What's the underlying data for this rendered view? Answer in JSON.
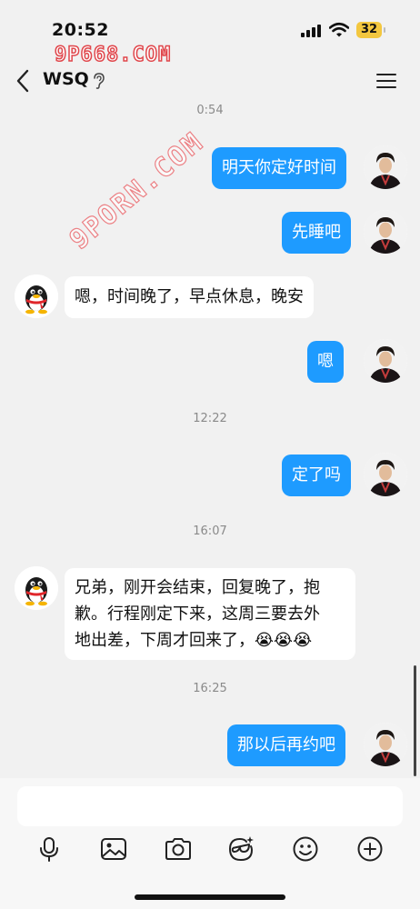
{
  "status_bar": {
    "time": "20:52",
    "battery": "32"
  },
  "watermark": {
    "top": "9P668.COM",
    "diagonal": "9PORN.COM"
  },
  "header": {
    "title": "WSQ"
  },
  "messages": [
    {
      "type": "timestamp",
      "text": "0:54"
    },
    {
      "type": "out",
      "text": "明天你定好时间"
    },
    {
      "type": "out",
      "text": "先睡吧"
    },
    {
      "type": "in",
      "text": "嗯，时间晚了，早点休息，晚安"
    },
    {
      "type": "out",
      "text": "嗯"
    },
    {
      "type": "timestamp",
      "text": "12:22"
    },
    {
      "type": "out",
      "text": "定了吗"
    },
    {
      "type": "timestamp",
      "text": "16:07"
    },
    {
      "type": "in",
      "lines": [
        "兄弟，刚开会结束，回复晚了，抱",
        "歉。行程刚定下来，这周三要去外",
        "地出差，下周才回来了，😭😭😭"
      ]
    },
    {
      "type": "timestamp",
      "text": "16:25"
    },
    {
      "type": "out",
      "text": "那以后再约吧"
    }
  ],
  "toolbar": {
    "icons": [
      "microphone-icon",
      "image-icon",
      "camera-icon",
      "sticker-icon",
      "emoji-icon",
      "plus-icon"
    ]
  },
  "colors": {
    "accent": "#1e9bff",
    "background": "#f1f1f1",
    "bubble_in": "#ffffff"
  }
}
